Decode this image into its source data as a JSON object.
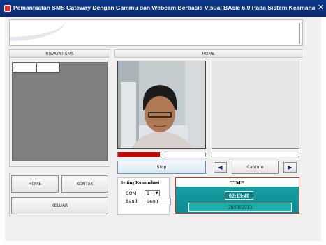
{
  "window": {
    "title": "Pemanfaatan SMS Gateway Dengan Gammu dan Webcam Berbasis Visual BAsic 6.0 Pada Sistem Keamanan R...",
    "close_glyph": "✕"
  },
  "panels": {
    "riwayat_header": "RIWAYAT SMS",
    "home_header": "HOME"
  },
  "buttons": {
    "stop": "Stop",
    "capture": "Capture",
    "prev": "◀",
    "next": "▶",
    "home": "HOME",
    "kontak": "KONTAK",
    "keluar": "KELUAR"
  },
  "settings": {
    "title": "Setting Komunikasi",
    "com_label": "COM",
    "com_value": "1",
    "baud_label": "Baud",
    "baud_value": "9600"
  },
  "time": {
    "title": "TIME",
    "clock": "02:13:40",
    "date": "20/08/2013"
  },
  "progress": {
    "webcam_level": 0.48
  },
  "colors": {
    "titlebar": "#0d3a8c",
    "progress_red": "#d40000",
    "time_teal": "#1aa6a6",
    "time_border": "#c0392b"
  },
  "icons": {
    "app": "app-icon",
    "close": "close-icon",
    "prev": "skip-previous-icon",
    "next": "skip-next-icon",
    "dropdown": "chevron-down-icon"
  }
}
